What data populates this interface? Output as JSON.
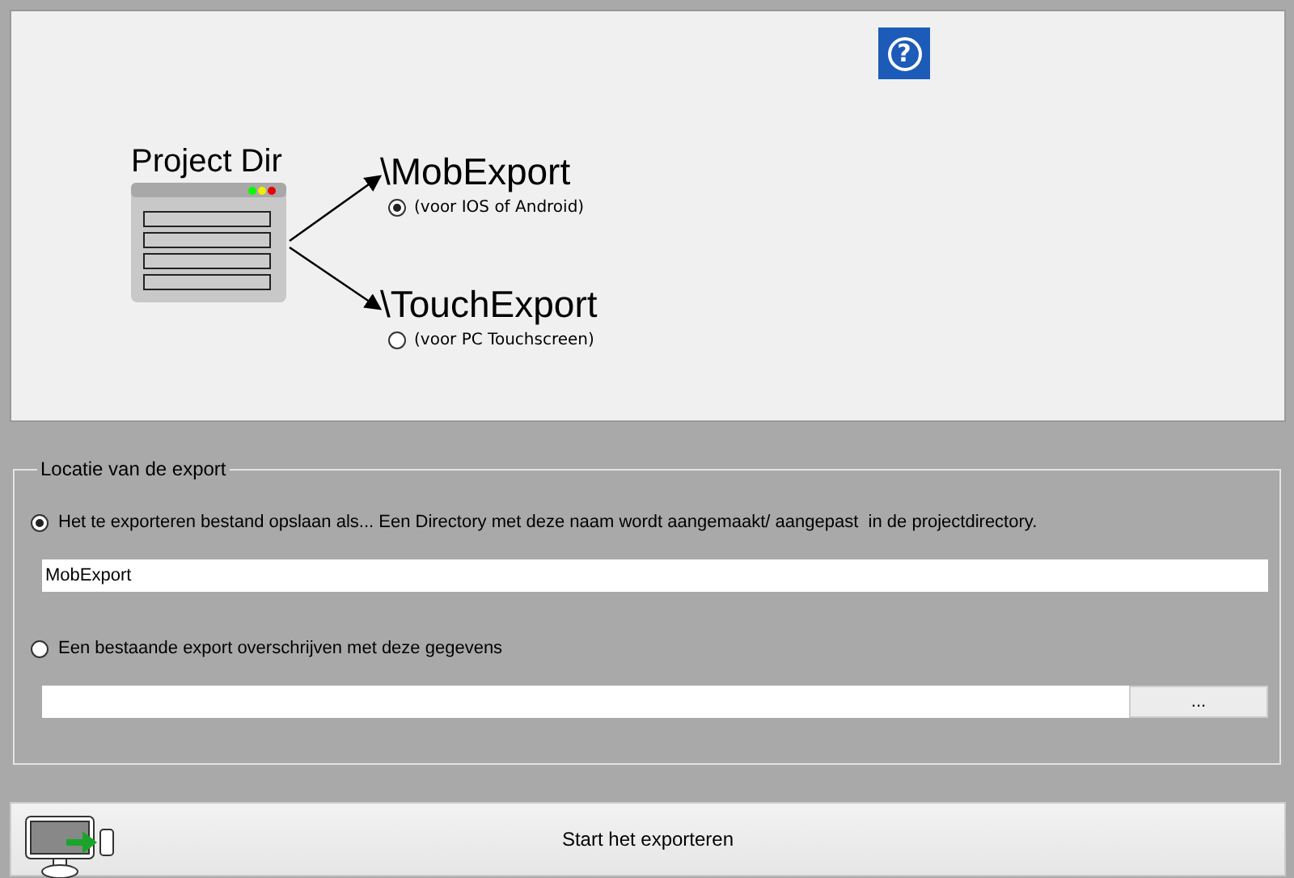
{
  "diagram": {
    "title": "Project Dir",
    "targets": [
      {
        "path": "\\MobExport",
        "description": "(voor IOS of Android)",
        "selected": true
      },
      {
        "path": "\\TouchExport",
        "description": "(voor PC Touchscreen)",
        "selected": false
      }
    ]
  },
  "help_button": {
    "label": "?"
  },
  "location": {
    "legend": "Locatie van de export",
    "options": [
      {
        "kind": "text",
        "label": "Het te exporteren bestand opslaan als... Een Directory met deze naam wordt aangemaakt/ aangepast  in de projectdirectory.",
        "selected": true,
        "value": "MobExport"
      },
      {
        "kind": "browse",
        "label": "Een bestaande export overschrijven met deze gegevens",
        "selected": false,
        "button": "..."
      }
    ]
  },
  "start_button": {
    "label": "Start het exporteren"
  }
}
